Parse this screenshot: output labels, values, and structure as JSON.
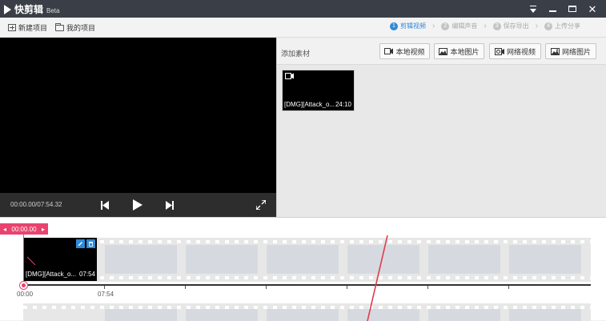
{
  "titlebar": {
    "title": "快剪辑",
    "beta": "Beta"
  },
  "toolbar": {
    "new_project": "新建项目",
    "my_projects": "我的项目"
  },
  "steps": [
    {
      "num": "1",
      "label": "剪辑视频"
    },
    {
      "num": "2",
      "label": "编辑声音"
    },
    {
      "num": "3",
      "label": "保存导出"
    },
    {
      "num": "4",
      "label": "上传分享"
    }
  ],
  "player": {
    "timecode": "00:00.00/07:54.32"
  },
  "library": {
    "title": "添加素材",
    "buttons": [
      "本地视频",
      "本地图片",
      "网络视频",
      "网络图片"
    ],
    "clip": {
      "name": "[DMG][Attack_o...",
      "duration": "24:10"
    }
  },
  "timeline": {
    "playhead": "00:00.00",
    "clip": {
      "name": "[DMG][Attack_o...",
      "duration": "07:54"
    },
    "ruler_labels": [
      "00:00",
      "07:54"
    ]
  },
  "colors": {
    "accent": "#2f8ad8",
    "playhead": "#e8436e",
    "titlebar": "#3a3f47"
  }
}
